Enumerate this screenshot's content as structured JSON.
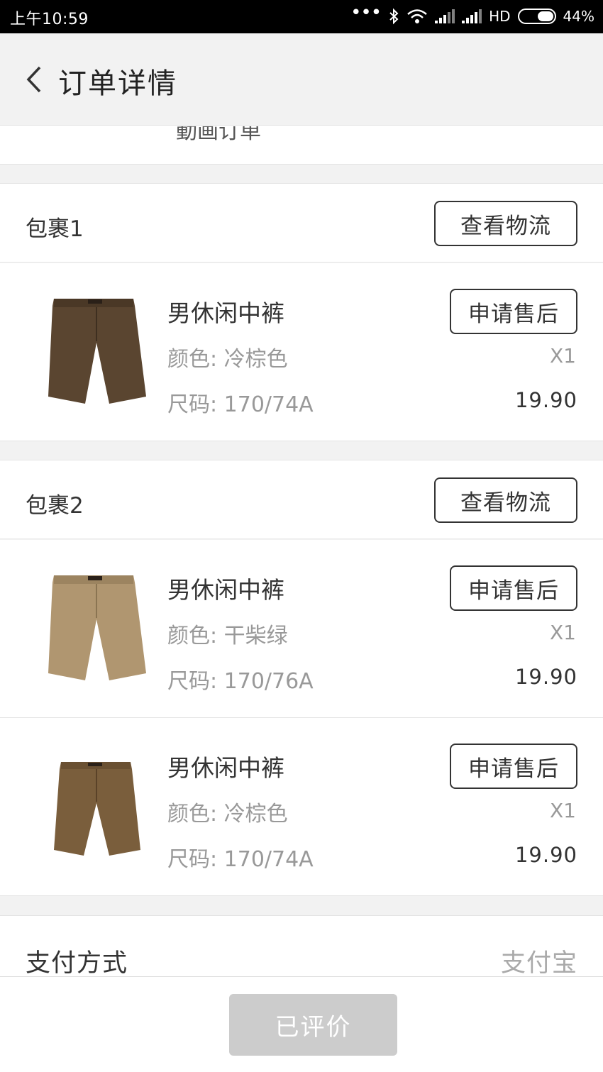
{
  "status_bar": {
    "time": "上午10:59",
    "network": "HD",
    "battery": "44%"
  },
  "header": {
    "title": "订单详情",
    "back_icon": "chevron-left-icon"
  },
  "partial_text": "動画订单",
  "packages": [
    {
      "title": "包裹1",
      "logistics_label": "查看物流",
      "items": [
        {
          "name": "男休闲中裤",
          "color": "颜色: 冷棕色",
          "size": "尺码: 170/74A",
          "quantity": "X1",
          "price": "19.90",
          "after_sale_label": "申请售后",
          "image_color": "#5a4530"
        }
      ]
    },
    {
      "title": "包裹2",
      "logistics_label": "查看物流",
      "items": [
        {
          "name": "男休闲中裤",
          "color": "颜色: 干柴绿",
          "size": "尺码: 170/76A",
          "quantity": "X1",
          "price": "19.90",
          "after_sale_label": "申请售后",
          "image_color": "#b09670"
        },
        {
          "name": "男休闲中裤",
          "color": "颜色: 冷棕色",
          "size": "尺码: 170/74A",
          "quantity": "X1",
          "price": "19.90",
          "after_sale_label": "申请售后",
          "image_color": "#7a5e3c"
        }
      ]
    }
  ],
  "payment": {
    "label": "支付方式",
    "value": "支付宝"
  },
  "bottom_button": {
    "label": "已评价"
  }
}
